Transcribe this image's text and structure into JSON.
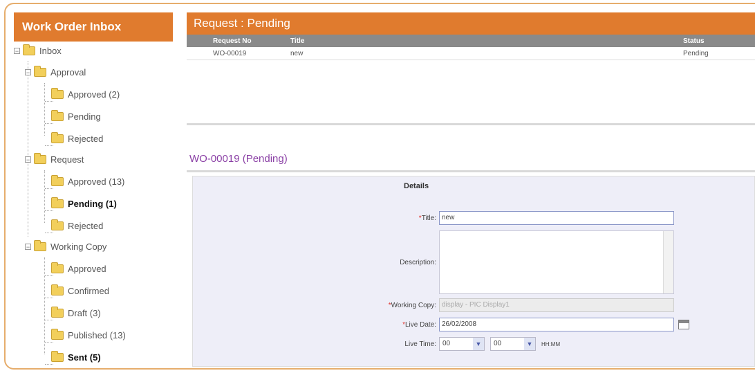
{
  "sidebar": {
    "title": "Work Order Inbox",
    "tree": {
      "inbox": "Inbox",
      "approval": {
        "label": "Approval",
        "children": [
          "Approved (2)",
          "Pending",
          "Rejected"
        ]
      },
      "request": {
        "label": "Request",
        "children": [
          "Approved (13)",
          "Pending (1)",
          "Rejected"
        ]
      },
      "working_copy": {
        "label": "Working Copy",
        "children": [
          "Approved",
          "Confirmed",
          "Draft (3)",
          "Published (13)",
          "Sent (5)"
        ]
      }
    }
  },
  "main": {
    "header": "Request : Pending",
    "table": {
      "columns": [
        "Request No",
        "Title",
        "Status"
      ],
      "rows": [
        [
          "WO-00019",
          "new",
          "Pending"
        ]
      ]
    },
    "work_order_title": "WO-00019 (Pending)",
    "details": {
      "title": "Details",
      "title_label": "Title:",
      "title_value": "new",
      "description_label": "Description:",
      "description_value": "",
      "working_copy_label": "Working Copy:",
      "working_copy_value": "display - PIC Display1",
      "live_date_label": "Live Date:",
      "live_date_value": "26/02/2008",
      "live_time_label": "Live Time:",
      "live_time_hour": "00",
      "live_time_minute": "00",
      "live_time_suffix": "HH:MM"
    }
  },
  "colors": {
    "accent": "#e07b2e",
    "frame": "#e6ad6c",
    "title_purple": "#8a3fa5",
    "details_bg": "#eeeef8"
  }
}
